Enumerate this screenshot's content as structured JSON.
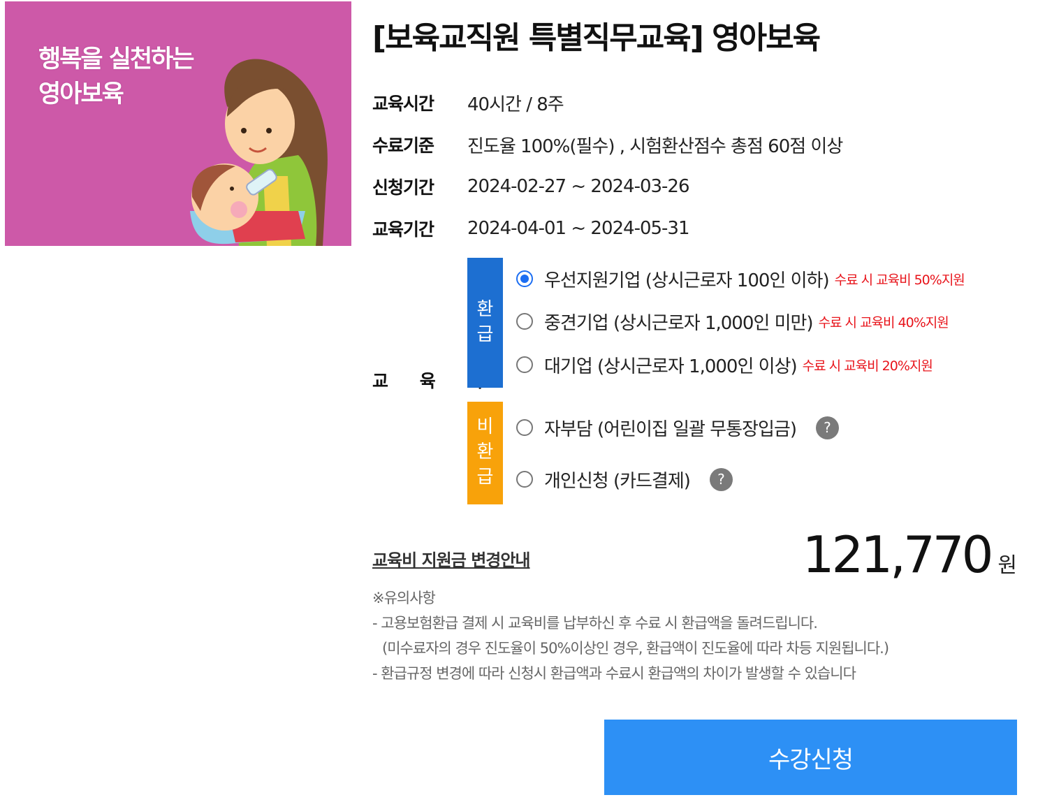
{
  "thumbnail": {
    "text_line1": "행복을 실천하는",
    "text_line2": "영아보육",
    "bg_color": "#cd59a8"
  },
  "course": {
    "title": "[보육교직원 특별직무교육] 영아보육"
  },
  "info": [
    {
      "label": "교육시간",
      "value": "40시간 / 8주"
    },
    {
      "label": "수료기준",
      "value": "진도율 100%(필수) , 시험환산점수 총점 60점 이상"
    },
    {
      "label": "신청기간",
      "value": "2024-02-27 ~ 2024-03-26"
    },
    {
      "label": "교육기간",
      "value": "2024-04-01 ~ 2024-05-31"
    }
  ],
  "fee": {
    "label": "교 육 비",
    "refund_tag": [
      "환",
      "급"
    ],
    "nonrefund_tag": [
      "비",
      "환",
      "급"
    ],
    "refund_options": [
      {
        "label": "우선지원기업 (상시근로자 100인 이하)",
        "note": "수료 시 교육비 50%지원",
        "checked": true
      },
      {
        "label": "중견기업 (상시근로자 1,000인 미만)",
        "note": "수료 시 교육비 40%지원",
        "checked": false
      },
      {
        "label": "대기업 (상시근로자 1,000인 이상)",
        "note": "수료 시 교육비 20%지원",
        "checked": false
      }
    ],
    "nonrefund_options": [
      {
        "label": "자부담 (어린이집 일괄 무통장입금)",
        "help": "?",
        "checked": false
      },
      {
        "label": "개인신청 (카드결제)",
        "help": "?",
        "checked": false
      }
    ],
    "colors": {
      "refund": "#1d6fd1",
      "nonrefund": "#f8a20a",
      "note": "#e8141b",
      "radio_checked": "#1c6ef2"
    }
  },
  "subsidy_link": "교육비 지원금 변경안내",
  "price": {
    "amount": "121,770",
    "unit": "원"
  },
  "notes": {
    "heading": "※유의사항",
    "lines": [
      "- 고용보험환급 결제 시 교육비를 납부하신 후 수료 시 환급액을 돌려드립니다.",
      "  (미수료자의 경우 진도율이 50%이상인 경우, 환급액이 진도율에 따라 차등 지원됩니다.)",
      "- 환급규정 변경에 따라 신청시 환급액과 수료시 환급액의 차이가 발생할 수 있습니다"
    ]
  },
  "apply_button": {
    "label": "수강신청",
    "color": "#2d90f5"
  }
}
